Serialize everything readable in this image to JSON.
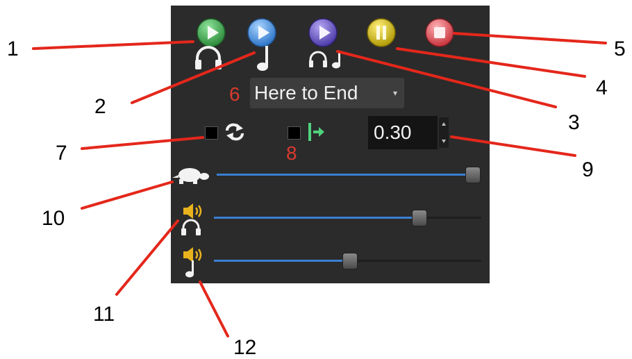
{
  "playback_panel": {
    "mode": {
      "value": "Here to End",
      "arrow": "▾"
    },
    "delay": {
      "value": "0.30"
    },
    "loop_checked": false,
    "pause_at_end_checked": false,
    "sliders": {
      "speed": {
        "level": 1.0
      },
      "headphone_volume": {
        "level": 0.77
      },
      "note_volume": {
        "level": 0.51
      }
    },
    "icons": {
      "play_headphones": "play-headphones-icon",
      "play_note": "play-note-icon",
      "play_both": "play-headphones-note-icon",
      "pause": "pause-icon",
      "stop": "stop-icon",
      "loop": "loop-icon",
      "pause_at_end": "pause-at-end-icon",
      "speed": "turtle-icon",
      "volume": "speaker-icon"
    },
    "colors": {
      "panel": "#2b2b2b",
      "green_button": "#3aa64a",
      "blue_button": "#3f8fe0",
      "purple_button": "#6a55c8",
      "yellow_button": "#d8c21a",
      "red_button": "#e0565e",
      "slider_fill": "#3b7fd3",
      "callout_line": "#e4271b",
      "red_label": "#d93a2f"
    }
  },
  "callouts": {
    "n1": "1",
    "n2": "2",
    "n3": "3",
    "n4": "4",
    "n5": "5",
    "n6": "6",
    "n7": "7",
    "n8": "8",
    "n9": "9",
    "n10": "10",
    "n11": "11",
    "n12": "12"
  }
}
